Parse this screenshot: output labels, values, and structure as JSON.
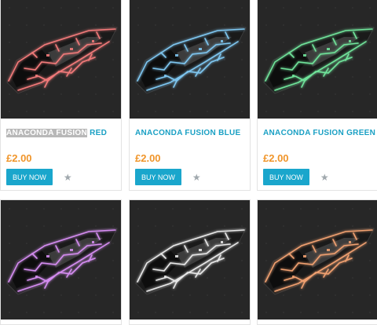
{
  "products": [
    {
      "title_highlight": "ANACONDA FUSION",
      "title_rest": " RED",
      "price": "£2.00",
      "buy_label": "BUY NOW",
      "star_icon": "★",
      "glow": "#f27a7a",
      "icon": "star-icon"
    },
    {
      "title_highlight": "",
      "title_rest": "ANACONDA FUSION BLUE",
      "price": "£2.00",
      "buy_label": "BUY NOW",
      "star_icon": "★",
      "glow": "#7ec6f0",
      "icon": "star-icon"
    },
    {
      "title_highlight": "",
      "title_rest": "ANACONDA FUSION GREEN",
      "price": "£2.00",
      "buy_label": "BUY NOW",
      "star_icon": "★",
      "glow": "#6fe39a",
      "icon": "star-icon"
    },
    {
      "glow": "#d48cf0"
    },
    {
      "glow": "#e8e8e8"
    },
    {
      "glow": "#f0a070"
    }
  ]
}
